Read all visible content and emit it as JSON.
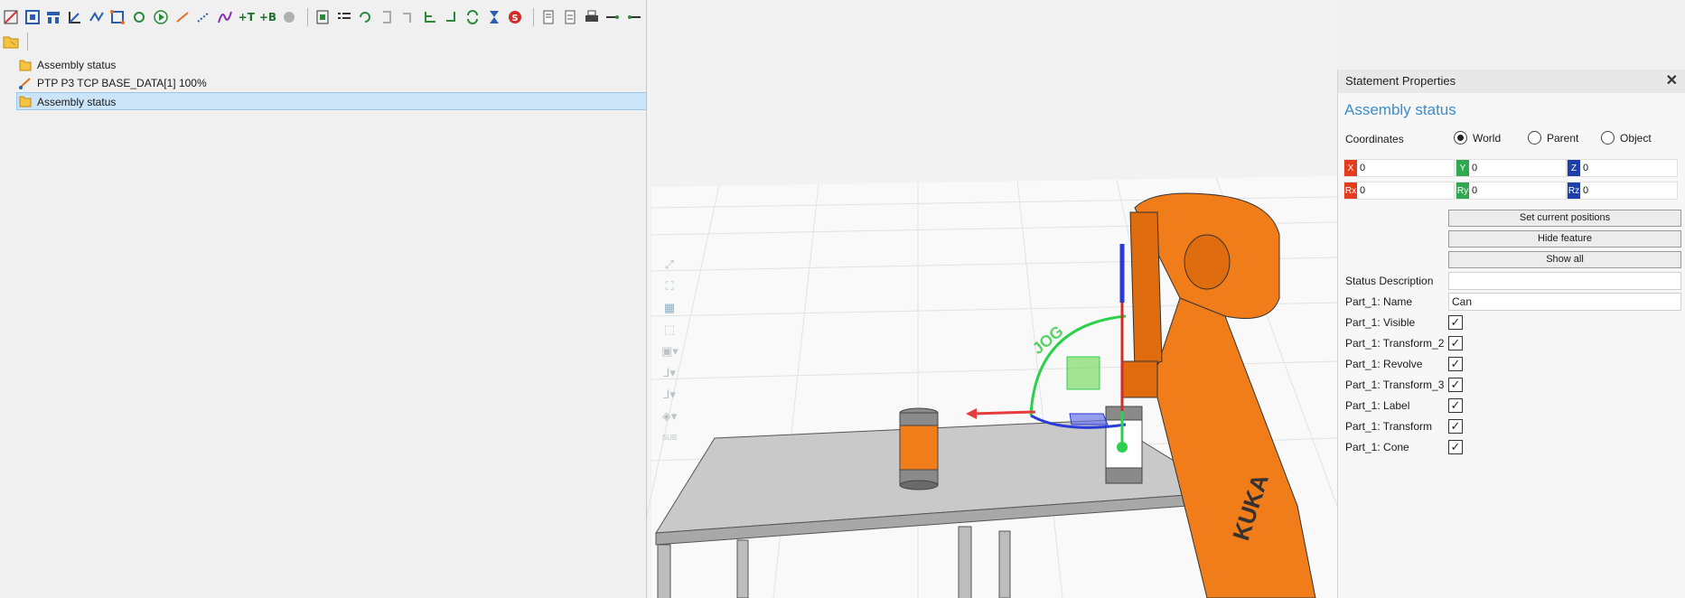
{
  "toolbar": {
    "icons": [
      "new-doc-icon",
      "frame-icon",
      "tree-icon",
      "angle-icon",
      "path-icon",
      "split-icon",
      "loop-icon",
      "play-icon",
      "link-icon",
      "dotted-link-icon",
      "curve-icon",
      "add-t-icon",
      "add-b-icon",
      "record-icon",
      "sep",
      "import-icon",
      "list-icon",
      "refresh-icon",
      "bracket-icon",
      "bracket2-icon",
      "branch-icon",
      "return-icon",
      "sync-icon",
      "hourglass-icon",
      "stop-icon",
      "sep",
      "notes-icon",
      "doc-icon",
      "print-icon",
      "export-icon",
      "export2-icon"
    ],
    "t_label": "+T",
    "b_label": "+B"
  },
  "tree": {
    "items": [
      {
        "label": "Assembly status",
        "selected": false
      },
      {
        "label": "PTP P3 TCP BASE_DATA[1] 100%",
        "selected": false
      },
      {
        "label": "Assembly status",
        "selected": true
      }
    ]
  },
  "viewport": {
    "jog_label": "JOG",
    "robot_brand": "KUKA"
  },
  "properties": {
    "title": "Statement Properties",
    "statement_name": "Assembly status",
    "coordinates_label": "Coordinates",
    "radio_world": "World",
    "radio_parent": "Parent",
    "radio_object": "Object",
    "selected_frame": "World",
    "x_tag": "X",
    "x_val": "0",
    "y_tag": "Y",
    "y_val": "0",
    "z_tag": "Z",
    "z_val": "0",
    "rx_tag": "Rx",
    "rx_val": "0",
    "ry_tag": "Ry",
    "ry_val": "0",
    "rz_tag": "Rz",
    "rz_val": "0",
    "btn_set_current": "Set current positions",
    "btn_hide_feature": "Hide feature",
    "btn_show_all": "Show all",
    "status_description_label": "Status Description",
    "status_description_value": "",
    "name_label": "Part_1: Name",
    "name_value": "Can",
    "checks": [
      {
        "label": "Part_1: Visible",
        "checked": true
      },
      {
        "label": "Part_1: Transform_2",
        "checked": true
      },
      {
        "label": "Part_1: Revolve",
        "checked": true
      },
      {
        "label": "Part_1: Transform_3",
        "checked": true
      },
      {
        "label": "Part_1: Label",
        "checked": true
      },
      {
        "label": "Part_1: Transform",
        "checked": true
      },
      {
        "label": "Part_1: Cone",
        "checked": true
      }
    ]
  },
  "colors": {
    "x_axis": "#e63c1e",
    "y_axis": "#2fa84f",
    "z_axis": "#1e3fa8",
    "robot": "#f07c1a",
    "selection": "#cce4f7"
  }
}
